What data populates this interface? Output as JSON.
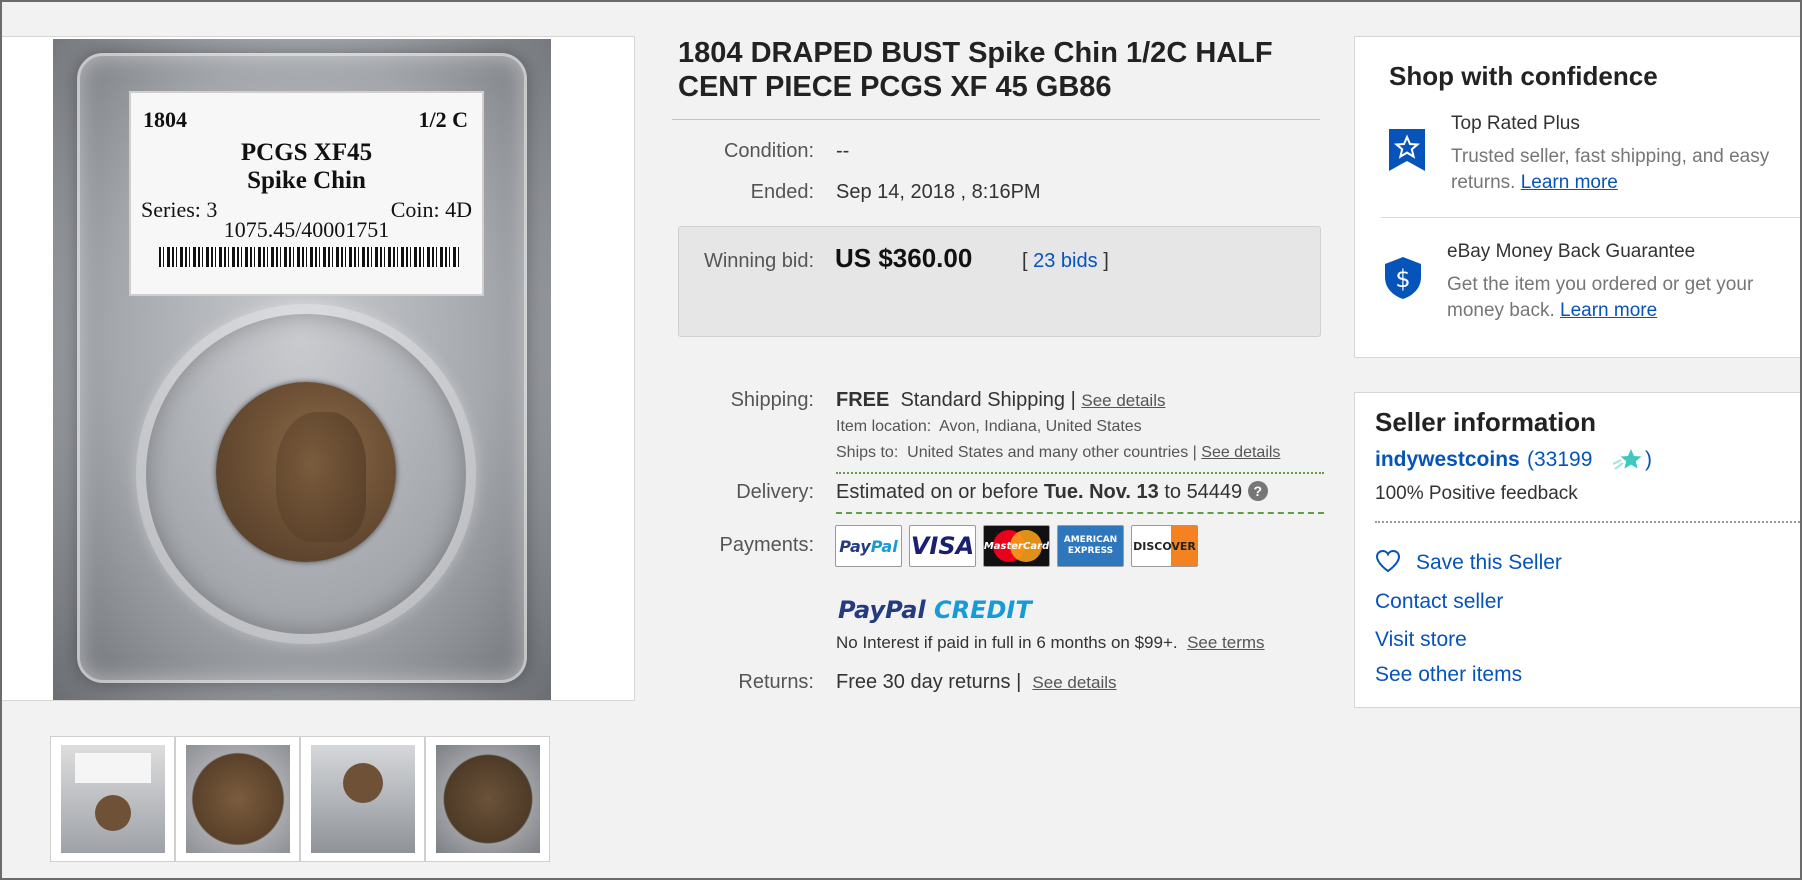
{
  "item": {
    "title": "1804 DRAPED BUST Spike Chin 1/2C HALF CENT PIECE PCGS XF 45 GB86",
    "slab_label": {
      "year": "1804",
      "denomination": "1/2 C",
      "grade": "PCGS XF45",
      "variety": "Spike Chin",
      "series": "Series: 3",
      "coin": "Coin: 4D",
      "cert": "1075.45/40001751"
    }
  },
  "details": {
    "condition_label": "Condition:",
    "condition_value": "--",
    "ended_label": "Ended:",
    "ended_value": "Sep 14, 2018 , 8:16PM",
    "winning_bid_label": "Winning bid:",
    "winning_bid_value": "US $360.00",
    "bids_open": "[",
    "bids_link": "23 bids",
    "bids_close": "]",
    "shipping_label": "Shipping:",
    "shipping_free": "FREE",
    "shipping_method": "Standard Shipping |",
    "shipping_details_link": "See details",
    "item_location_label": "Item location:",
    "item_location_value": "Avon, Indiana, United States",
    "ships_to_label": "Ships to:",
    "ships_to_value": "United States and many other countries |",
    "ships_to_link": "See details",
    "delivery_label": "Delivery:",
    "delivery_prefix": "Estimated on or before",
    "delivery_date": "Tue. Nov. 13",
    "delivery_to": "to",
    "delivery_zip": "54449",
    "payments_label": "Payments:",
    "payment_cards": [
      "PayPal",
      "VISA",
      "MasterCard",
      "AMERICAN EXPRESS",
      "DISCOVER"
    ],
    "paypal_credit_1": "PayPal",
    "paypal_credit_2": "CREDIT",
    "paypal_credit_text": "No Interest if paid in full in 6 months on $99+.",
    "paypal_credit_link": "See terms",
    "returns_label": "Returns:",
    "returns_value": "Free 30 day returns |",
    "returns_link": "See details"
  },
  "confidence": {
    "title": "Shop with confidence",
    "trp_head": "Top Rated Plus",
    "trp_text": "Trusted seller, fast shipping, and easy returns.",
    "trp_link": "Learn more",
    "mbg_head": "eBay Money Back Guarantee",
    "mbg_text": "Get the item you ordered or get your money back.",
    "mbg_link": "Learn more"
  },
  "seller": {
    "title": "Seller information",
    "name": "indywestcoins",
    "score_open": "(",
    "score": "33199",
    "score_close": ")",
    "feedback": "100% Positive feedback",
    "save_seller": "Save this Seller",
    "contact_seller": "Contact seller",
    "visit_store": "Visit store",
    "other_items": "See other items"
  },
  "colors": {
    "link": "#0654ba",
    "badge": "#0654ba",
    "star": "#3fc8c0",
    "dotted": "#5ca142"
  },
  "icons": {
    "help": "?",
    "heart": "heart-outline-icon",
    "trp_badge": "star-ribbon-icon",
    "mbg_badge": "dollar-shield-icon",
    "star": "shooting-star-icon"
  }
}
